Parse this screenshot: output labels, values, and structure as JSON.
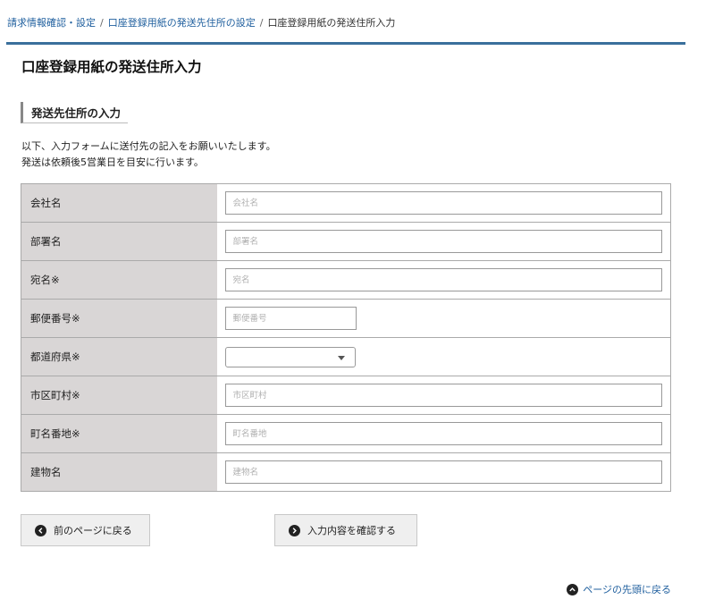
{
  "breadcrumb": {
    "items": [
      "請求情報確認・設定",
      "口座登録用紙の発送先住所の設定"
    ],
    "separator": "/",
    "current": "口座登録用紙の発送住所入力"
  },
  "page": {
    "title": "口座登録用紙の発送住所入力"
  },
  "section": {
    "heading": "発送先住所の入力"
  },
  "intro": {
    "line1": "以下、入力フォームに送付先の記入をお願いいたします。",
    "line2": "発送は依頼後5営業日を目安に行います。"
  },
  "form": {
    "company": {
      "label": "会社名",
      "placeholder": "会社名",
      "value": ""
    },
    "department": {
      "label": "部署名",
      "placeholder": "部署名",
      "value": ""
    },
    "recipient": {
      "label": "宛名※",
      "placeholder": "宛名",
      "value": ""
    },
    "postal": {
      "label": "郵便番号※",
      "placeholder": "郵便番号",
      "value": ""
    },
    "prefecture": {
      "label": "都道府県※",
      "selected": ""
    },
    "city": {
      "label": "市区町村※",
      "placeholder": "市区町村",
      "value": ""
    },
    "street": {
      "label": "町名番地※",
      "placeholder": "町名番地",
      "value": ""
    },
    "building": {
      "label": "建物名",
      "placeholder": "建物名",
      "value": ""
    }
  },
  "buttons": {
    "back": "前のページに戻る",
    "confirm": "入力内容を確認する"
  },
  "footer": {
    "top_link": "ページの先頭に戻る"
  },
  "colors": {
    "accent_rule": "#3a6f9c",
    "link": "#1f5f9e",
    "label_bg": "#d9d6d6"
  },
  "icons": {
    "back": "arrow-left-circle-icon",
    "confirm": "arrow-right-circle-icon",
    "top": "chevron-up-circle-icon",
    "select": "caret-down-icon"
  }
}
